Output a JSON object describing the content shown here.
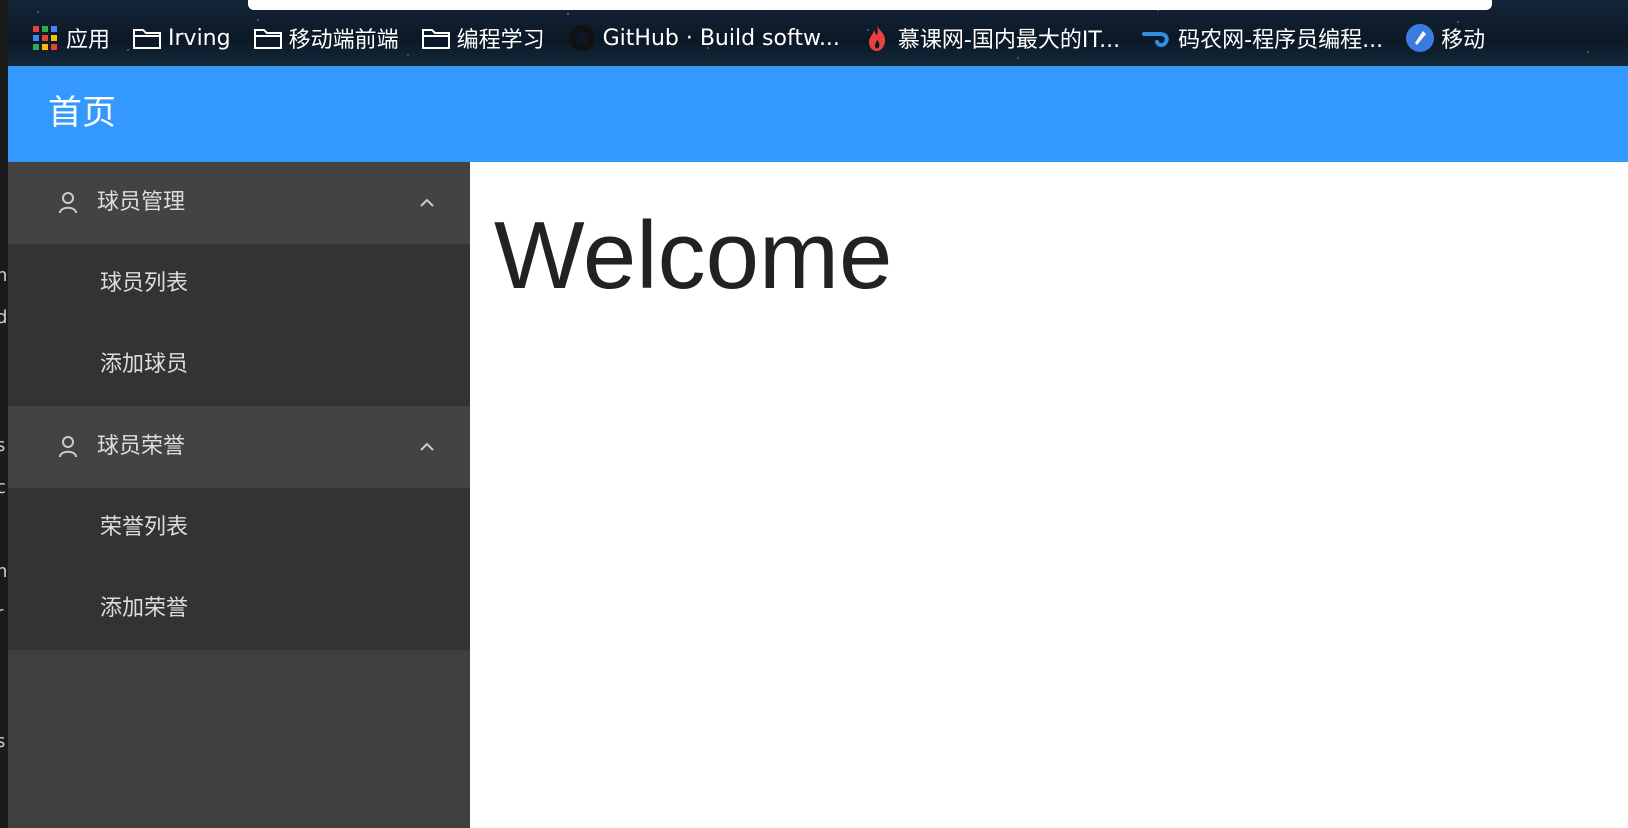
{
  "left_gutter_chars": [
    "n",
    "d",
    "s",
    "c",
    "l",
    "n",
    "r",
    "s"
  ],
  "bookmarks": [
    {
      "label": "应用",
      "icon": "apps-grid-icon"
    },
    {
      "label": "Irving",
      "icon": "folder-icon"
    },
    {
      "label": "移动端前端",
      "icon": "folder-icon"
    },
    {
      "label": "编程学习",
      "icon": "folder-icon"
    },
    {
      "label": "GitHub · Build softw...",
      "icon": "github-icon"
    },
    {
      "label": "慕课网-国内最大的IT...",
      "icon": "flame-icon"
    },
    {
      "label": "码农网-程序员编程...",
      "icon": "codenong-icon"
    },
    {
      "label": "移动",
      "icon": "rocket-icon"
    }
  ],
  "header": {
    "title": "首页"
  },
  "sidebar": {
    "groups": [
      {
        "label": "球员管理",
        "icon": "user-icon",
        "expanded": true,
        "items": [
          {
            "label": "球员列表"
          },
          {
            "label": "添加球员"
          }
        ]
      },
      {
        "label": "球员荣誉",
        "icon": "user-icon",
        "expanded": true,
        "items": [
          {
            "label": "荣誉列表"
          },
          {
            "label": "添加荣誉"
          }
        ]
      }
    ]
  },
  "main": {
    "heading": "Welcome"
  },
  "colors": {
    "header_bg": "#3399ff",
    "sidebar_bg": "#3f3f3f",
    "submenu_bg": "#333333",
    "content_bg": "#ffffff"
  }
}
